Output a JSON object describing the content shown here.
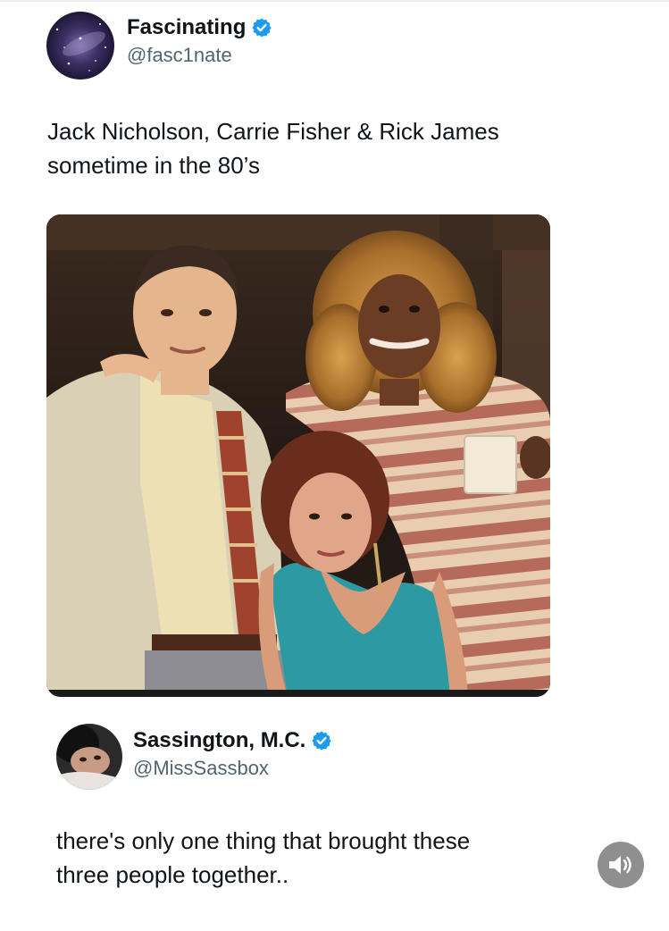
{
  "tweet": {
    "author": {
      "display_name": "Fascinating",
      "handle": "@fasc1nate",
      "verified": true,
      "avatar_icon": "galaxy-avatar"
    },
    "text_lines": [
      "Jack Nicholson, Carrie Fisher & Rick James",
      "sometime in the 80’s"
    ],
    "media": {
      "type": "photo",
      "icon": "vintage-group-photo"
    }
  },
  "reply": {
    "author": {
      "display_name": "Sassington, M.C.",
      "handle": "@MissSassbox",
      "verified": true,
      "avatar_icon": "person-photo-avatar"
    },
    "text_lines": [
      "there's only one thing that brought these",
      "three people together.."
    ]
  },
  "controls": {
    "sound_icon": "speaker-icon"
  },
  "colors": {
    "verified_blue": "#1d9bf0",
    "text_primary": "#0f1419",
    "text_secondary": "#536471",
    "sound_button_bg": "#8f8f8f"
  }
}
